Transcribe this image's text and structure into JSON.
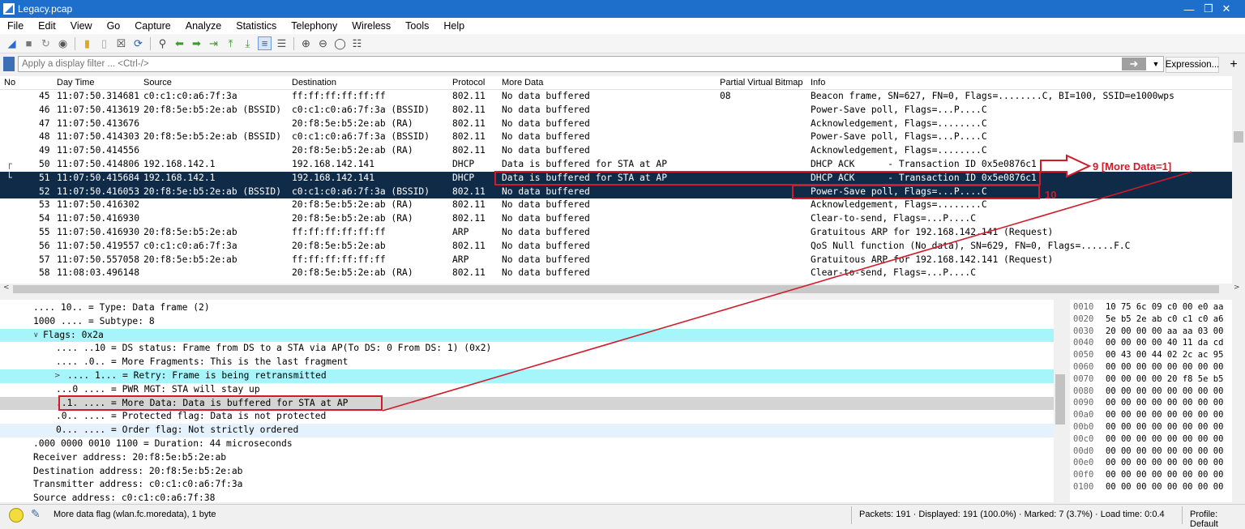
{
  "window": {
    "title": "Legacy.pcap"
  },
  "menu": [
    "File",
    "Edit",
    "View",
    "Go",
    "Capture",
    "Analyze",
    "Statistics",
    "Telephony",
    "Wireless",
    "Tools",
    "Help"
  ],
  "filter": {
    "placeholder": "Apply a display filter ... <Ctrl-/>",
    "expression_label": "Expression...",
    "add_label": "+"
  },
  "columns": [
    "No",
    "Day Time",
    "Source",
    "Destination",
    "Protocol",
    "More Data",
    "Partial Virtual Bitmap",
    "Info"
  ],
  "packets": [
    {
      "no": "45",
      "time": "11:07:50.314681",
      "src": "c0:c1:c0:a6:7f:3a",
      "dst": "ff:ff:ff:ff:ff:ff",
      "proto": "802.11",
      "more": "No data buffered",
      "pvb": "08",
      "info": "Beacon frame, SN=627, FN=0, Flags=........C, BI=100, SSID=e1000wps"
    },
    {
      "no": "46",
      "time": "11:07:50.413619",
      "src": "20:f8:5e:b5:2e:ab (BSSID)",
      "dst": "c0:c1:c0:a6:7f:3a (BSSID)",
      "proto": "802.11",
      "more": "No data buffered",
      "pvb": "",
      "info": "Power-Save poll, Flags=...P....C"
    },
    {
      "no": "47",
      "time": "11:07:50.413676",
      "src": "",
      "dst": "20:f8:5e:b5:2e:ab (RA)",
      "proto": "802.11",
      "more": "No data buffered",
      "pvb": "",
      "info": "Acknowledgement, Flags=........C"
    },
    {
      "no": "48",
      "time": "11:07:50.414303",
      "src": "20:f8:5e:b5:2e:ab (BSSID)",
      "dst": "c0:c1:c0:a6:7f:3a (BSSID)",
      "proto": "802.11",
      "more": "No data buffered",
      "pvb": "",
      "info": "Power-Save poll, Flags=...P....C"
    },
    {
      "no": "49",
      "time": "11:07:50.414556",
      "src": "",
      "dst": "20:f8:5e:b5:2e:ab (RA)",
      "proto": "802.11",
      "more": "No data buffered",
      "pvb": "",
      "info": "Acknowledgement, Flags=........C"
    },
    {
      "no": "50",
      "time": "11:07:50.414806",
      "src": "192.168.142.1",
      "dst": "192.168.142.141",
      "proto": "DHCP",
      "more": "Data is buffered for STA at AP",
      "pvb": "",
      "info": "DHCP ACK      - Transaction ID 0x5e0876c1"
    },
    {
      "no": "51",
      "time": "11:07:50.415684",
      "src": "192.168.142.1",
      "dst": "192.168.142.141",
      "proto": "DHCP",
      "more": "Data is buffered for STA at AP",
      "pvb": "",
      "info": "DHCP ACK      - Transaction ID 0x5e0876c1"
    },
    {
      "no": "52",
      "time": "11:07:50.416053",
      "src": "20:f8:5e:b5:2e:ab (BSSID)",
      "dst": "c0:c1:c0:a6:7f:3a (BSSID)",
      "proto": "802.11",
      "more": "No data buffered",
      "pvb": "",
      "info": "Power-Save poll, Flags=...P....C"
    },
    {
      "no": "53",
      "time": "11:07:50.416302",
      "src": "",
      "dst": "20:f8:5e:b5:2e:ab (RA)",
      "proto": "802.11",
      "more": "No data buffered",
      "pvb": "",
      "info": "Acknowledgement, Flags=........C"
    },
    {
      "no": "54",
      "time": "11:07:50.416930",
      "src": "",
      "dst": "20:f8:5e:b5:2e:ab (RA)",
      "proto": "802.11",
      "more": "No data buffered",
      "pvb": "",
      "info": "Clear-to-send, Flags=...P....C"
    },
    {
      "no": "55",
      "time": "11:07:50.416930",
      "src": "20:f8:5e:b5:2e:ab",
      "dst": "ff:ff:ff:ff:ff:ff",
      "proto": "ARP",
      "more": "No data buffered",
      "pvb": "",
      "info": "Gratuitous ARP for 192.168.142.141 (Request)"
    },
    {
      "no": "56",
      "time": "11:07:50.419557",
      "src": "c0:c1:c0:a6:7f:3a",
      "dst": "20:f8:5e:b5:2e:ab",
      "proto": "802.11",
      "more": "No data buffered",
      "pvb": "",
      "info": "QoS Null function (No data), SN=629, FN=0, Flags=......F.C"
    },
    {
      "no": "57",
      "time": "11:07:50.557058",
      "src": "20:f8:5e:b5:2e:ab",
      "dst": "ff:ff:ff:ff:ff:ff",
      "proto": "ARP",
      "more": "No data buffered",
      "pvb": "",
      "info": "Gratuitous ARP for 192.168.142.141 (Request)"
    },
    {
      "no": "58",
      "time": "11:08:03.496148",
      "src": "",
      "dst": "20:f8:5e:b5:2e:ab (RA)",
      "proto": "802.11",
      "more": "No data buffered",
      "pvb": "",
      "info": "Clear-to-send, Flags=...P....C"
    }
  ],
  "details": [
    {
      "text": ".... 10.. = Type: Data frame (2)",
      "indent": 3,
      "chev": ""
    },
    {
      "text": "1000 .... = Subtype: 8",
      "indent": 3,
      "chev": ""
    },
    {
      "text": "Flags: 0x2a",
      "indent": 5,
      "chev": "v"
    },
    {
      "text": ".... ..10 = DS status: Frame from DS to a STA via AP(To DS: 0 From DS: 1) (0x2)",
      "indent": 7,
      "chev": ""
    },
    {
      "text": ".... .0.. = More Fragments: This is the last fragment",
      "indent": 7,
      "chev": ""
    },
    {
      "text": ".... 1... = Retry: Frame is being retransmitted",
      "indent": 7,
      "chev": ">"
    },
    {
      "text": "...0 .... = PWR MGT: STA will stay up",
      "indent": 7,
      "chev": ""
    },
    {
      "text": "..1. .... = More Data: Data is buffered for STA at AP",
      "indent": 7,
      "chev": ""
    },
    {
      "text": ".0.. .... = Protected flag: Data is not protected",
      "indent": 7,
      "chev": ""
    },
    {
      "text": "0... .... = Order flag: Not strictly ordered",
      "indent": 7,
      "chev": ""
    },
    {
      "text": ".000 0000 0010 1100 = Duration: 44 microseconds",
      "indent": 3,
      "chev": ""
    },
    {
      "text": "Receiver address: 20:f8:5e:b5:2e:ab",
      "indent": 3,
      "chev": ""
    },
    {
      "text": "Destination address: 20:f8:5e:b5:2e:ab",
      "indent": 3,
      "chev": ""
    },
    {
      "text": "Transmitter address: c0:c1:c0:a6:7f:3a",
      "indent": 3,
      "chev": ""
    },
    {
      "text": "Source address: c0:c1:c0:a6:7f:38",
      "indent": 3,
      "chev": ""
    }
  ],
  "bytes": [
    {
      "off": "0010",
      "hex": "10 75 6c 09 c0 00 e0 aa"
    },
    {
      "off": "0020",
      "hex": "5e b5 2e ab c0 c1 c0 a6"
    },
    {
      "off": "0030",
      "hex": "20 00 00 00 aa aa 03 00"
    },
    {
      "off": "0040",
      "hex": "00 00 00 00 40 11 da cd"
    },
    {
      "off": "0050",
      "hex": "00 43 00 44 02 2c ac 95"
    },
    {
      "off": "0060",
      "hex": "00 00 00 00 00 00 00 00"
    },
    {
      "off": "0070",
      "hex": "00 00 00 00 20 f8 5e b5"
    },
    {
      "off": "0080",
      "hex": "00 00 00 00 00 00 00 00"
    },
    {
      "off": "0090",
      "hex": "00 00 00 00 00 00 00 00"
    },
    {
      "off": "00a0",
      "hex": "00 00 00 00 00 00 00 00"
    },
    {
      "off": "00b0",
      "hex": "00 00 00 00 00 00 00 00"
    },
    {
      "off": "00c0",
      "hex": "00 00 00 00 00 00 00 00"
    },
    {
      "off": "00d0",
      "hex": "00 00 00 00 00 00 00 00"
    },
    {
      "off": "00e0",
      "hex": "00 00 00 00 00 00 00 00"
    },
    {
      "off": "00f0",
      "hex": "00 00 00 00 00 00 00 00"
    },
    {
      "off": "0100",
      "hex": "00 00 00 00 00 00 00 00"
    }
  ],
  "status": {
    "field": "More data flag (wlan.fc.moredata), 1 byte",
    "counts": "Packets: 191 · Displayed: 191 (100.0%) · Marked: 7 (3.7%) · Load time: 0:0.4",
    "profile": "Profile: Default"
  },
  "annotations": {
    "label_9": "9 [More Data=1]",
    "label_10": "10",
    "color": "#d21a2a"
  },
  "colors": {
    "selected_row": "#0f2b47",
    "highlight_cyan": "#a5f5fb",
    "highlight_gray": "#d4d4d4",
    "titlebar": "#1e6fcc"
  }
}
